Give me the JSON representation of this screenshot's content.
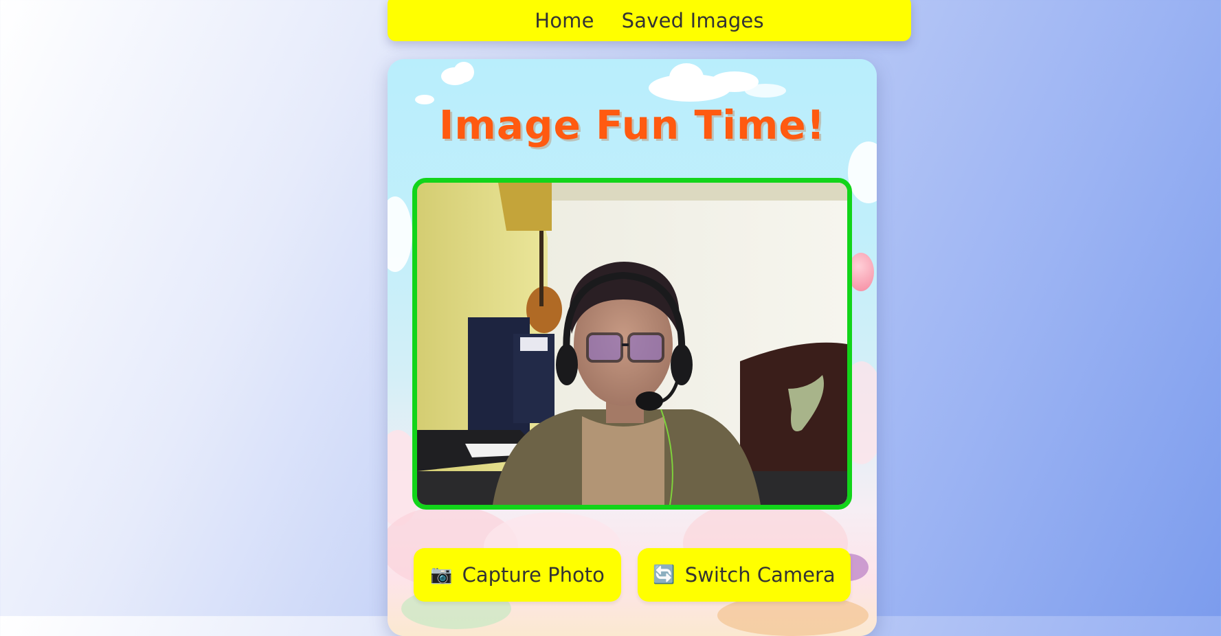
{
  "nav": {
    "home_label": "Home",
    "saved_label": "Saved Images"
  },
  "main": {
    "title": "Image Fun Time!"
  },
  "video": {
    "description": "live camera preview"
  },
  "actions": {
    "capture_icon": "📷",
    "capture_label": "Capture Photo",
    "switch_icon": "🔄",
    "switch_label": "Switch Camera"
  },
  "colors": {
    "nav_bg": "#ffff00",
    "title": "#ff5a10",
    "frame_border": "#12d41a",
    "button_bg": "#ffff00"
  },
  "icons": {
    "capture": "camera-icon",
    "switch": "switch-camera-icon"
  }
}
